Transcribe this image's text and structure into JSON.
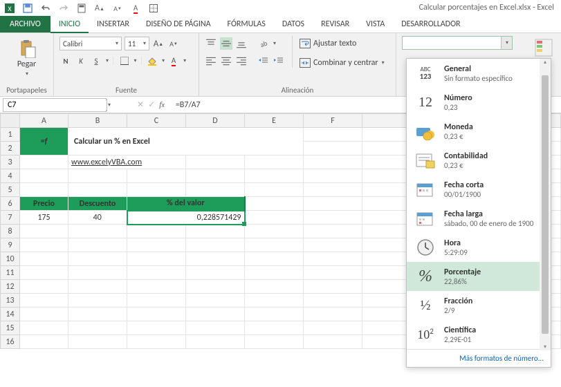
{
  "title": "Calcular porcentajes en Excel.xlsx - Excel",
  "tabs": {
    "file": "ARCHIVO",
    "list": [
      "INICIO",
      "INSERTAR",
      "DISEÑO DE PÁGINA",
      "FÓRMULAS",
      "DATOS",
      "REVISAR",
      "VISTA",
      "DESARROLLADOR"
    ],
    "activeIndex": 0
  },
  "ribbon": {
    "paste": "Pegar",
    "clipboard_label": "Portapapeles",
    "font": {
      "name": "Calibri",
      "size": "11",
      "label": "Fuente"
    },
    "alignment": {
      "wrap": "Ajustar texto",
      "merge": "Combinar y centrar",
      "label": "Alineación"
    }
  },
  "namebox": "C7",
  "formula": "=B7/A7",
  "sheet": {
    "columns": [
      "A",
      "B",
      "C",
      "D",
      "E",
      "F"
    ],
    "rows": 16,
    "title": "Calcular un % en Excel",
    "link": "www.excelyVBA.com",
    "headers": {
      "a": "Precio",
      "b": "Descuento",
      "c": "% del valor"
    },
    "vals": {
      "a7": "175",
      "b7": "40",
      "c7": "0,228571429"
    }
  },
  "formatDropdown": {
    "items": [
      {
        "name": "General",
        "example": "Sin formato específico",
        "icon": "general"
      },
      {
        "name": "Número",
        "example": "0,23",
        "icon": "numero"
      },
      {
        "name": "Moneda",
        "example": "0,23 €",
        "icon": "moneda"
      },
      {
        "name": "Contabilidad",
        "example": "0,23 €",
        "icon": "contab"
      },
      {
        "name": "Fecha corta",
        "example": "00/01/1900",
        "icon": "fechac"
      },
      {
        "name": "Fecha larga",
        "example": "sábado, 00 de enero de 1900",
        "icon": "fechal"
      },
      {
        "name": "Hora",
        "example": "5:29:09",
        "icon": "hora"
      },
      {
        "name": "Porcentaje",
        "example": "22,86%",
        "icon": "porcentaje",
        "selected": true
      },
      {
        "name": "Fracción",
        "example": " 2/9",
        "icon": "fraccion"
      },
      {
        "name": "Científica",
        "example": "2,29E-01",
        "icon": "cientifica"
      }
    ],
    "footer": "Más formatos de número..."
  }
}
